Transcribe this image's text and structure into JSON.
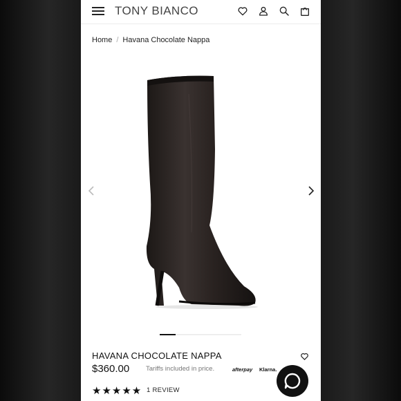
{
  "header": {
    "brand": "TONY BIANCO",
    "icons": [
      "hamburger-menu-icon",
      "heart-icon",
      "user-icon",
      "search-icon",
      "shopping-bag-icon"
    ]
  },
  "breadcrumb": {
    "home": "Home",
    "separator": "/",
    "current": "Havana Chocolate Nappa"
  },
  "gallery": {
    "slide_index": 1,
    "slide_count": 4
  },
  "product": {
    "name": "HAVANA CHOCOLATE NAPPA",
    "price": "$360.00",
    "tariff_note": "Tariffs included in price.",
    "payment_options": [
      "afterpay",
      "Klarna."
    ],
    "rating_stars": "★★★★★",
    "review_count_label": "1 REVIEW"
  },
  "colors": {
    "text": "#111111",
    "muted": "#777777",
    "boot": "#2a2321"
  }
}
